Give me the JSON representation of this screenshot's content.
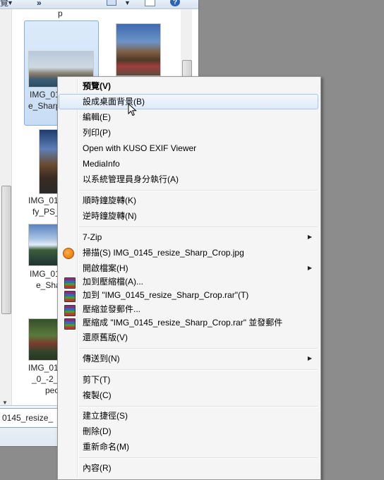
{
  "explorer": {
    "toolbar": {
      "view_label": "覽",
      "more_label": "»"
    },
    "items": [
      {
        "caption_lines": [
          "p"
        ]
      },
      {
        "caption_lines": [
          "IMG_01",
          "e_Sharp"
        ]
      },
      {
        "caption_lines": [
          "IMG_01",
          "fy_PS_"
        ]
      },
      {
        "caption_lines": [
          "IMG_01",
          "e_Sha"
        ]
      },
      {
        "caption_lines": [
          "IMG_01",
          "_0_-2_t",
          "pec"
        ]
      }
    ],
    "filename_value": "0145_resize_"
  },
  "context_menu": {
    "items": [
      {
        "type": "item",
        "label": "預覽(V)",
        "bold": true
      },
      {
        "type": "item",
        "label": "設成桌面背景(B)",
        "highlighted": true
      },
      {
        "type": "item",
        "label": "編輯(E)"
      },
      {
        "type": "item",
        "label": "列印(P)"
      },
      {
        "type": "item",
        "label": "Open with KUSO EXIF Viewer"
      },
      {
        "type": "item",
        "label": "MediaInfo"
      },
      {
        "type": "item",
        "label": "以系統管理員身分執行(A)"
      },
      {
        "type": "separator"
      },
      {
        "type": "item",
        "label": "順時鐘旋轉(K)"
      },
      {
        "type": "item",
        "label": "逆時鐘旋轉(N)"
      },
      {
        "type": "separator"
      },
      {
        "type": "item",
        "label": "7-Zip",
        "submenu": true
      },
      {
        "type": "item",
        "label": "掃描(S) IMG_0145_resize_Sharp_Crop.jpg",
        "icon": "avast-icon"
      },
      {
        "type": "item",
        "label": "開啟檔案(H)",
        "submenu": true
      },
      {
        "type": "item",
        "label": "加到壓縮檔(A)...",
        "icon": "winrar-icon"
      },
      {
        "type": "item",
        "label": "加到 \"IMG_0145_resize_Sharp_Crop.rar\"(T)",
        "icon": "winrar-icon"
      },
      {
        "type": "item",
        "label": "壓縮並發郵件...",
        "icon": "winrar-icon"
      },
      {
        "type": "item",
        "label": "壓縮成 \"IMG_0145_resize_Sharp_Crop.rar\" 並發郵件",
        "icon": "winrar-icon"
      },
      {
        "type": "item",
        "label": "還原舊版(V)"
      },
      {
        "type": "separator"
      },
      {
        "type": "item",
        "label": "傳送到(N)",
        "submenu": true
      },
      {
        "type": "separator"
      },
      {
        "type": "item",
        "label": "剪下(T)"
      },
      {
        "type": "item",
        "label": "複製(C)"
      },
      {
        "type": "separator"
      },
      {
        "type": "item",
        "label": "建立捷徑(S)"
      },
      {
        "type": "item",
        "label": "刪除(D)"
      },
      {
        "type": "item",
        "label": "重新命名(M)"
      },
      {
        "type": "separator"
      },
      {
        "type": "item",
        "label": "內容(R)"
      }
    ]
  }
}
